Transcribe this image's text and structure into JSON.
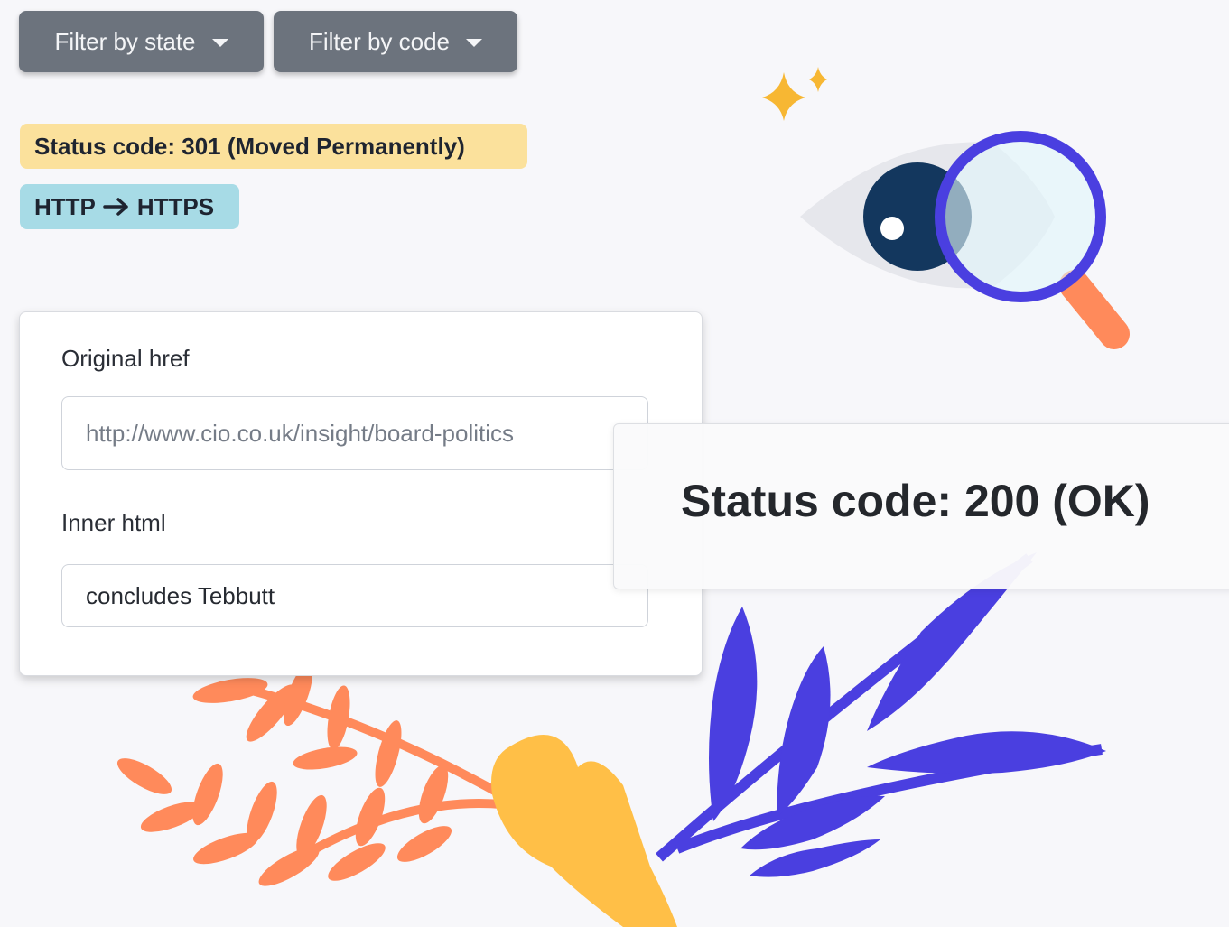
{
  "filters": {
    "state_label": "Filter by state",
    "code_label": "Filter by code"
  },
  "badges": {
    "status": "Status code: 301 (Moved Permanently)",
    "protocol_from": "HTTP",
    "protocol_to": "HTTPS"
  },
  "form": {
    "original_href_label": "Original href",
    "original_href_placeholder": "http://www.cio.co.uk/insight/board-politics",
    "inner_html_label": "Inner html",
    "inner_html_value": "concludes Tebbutt"
  },
  "status_panel": {
    "text": "Status code: 200 (OK)"
  },
  "colors": {
    "background": "#f7f7fa",
    "button": "#6c737d",
    "badge_yellow": "#fbe19c",
    "badge_blue": "#a7dbe6",
    "accent_blue": "#4a3fe0",
    "accent_orange": "#ff8a5b",
    "accent_yellow": "#ffbf47"
  },
  "icons": [
    "caret-down-icon",
    "arrow-right-icon",
    "eye-icon",
    "magnifier-icon",
    "sparkle-icon",
    "leaf-icon"
  ]
}
